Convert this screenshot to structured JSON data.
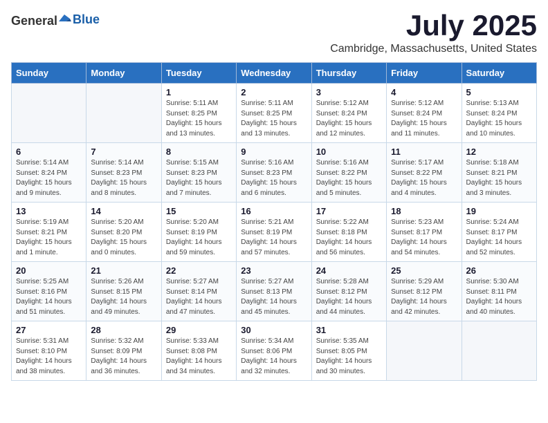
{
  "header": {
    "logo_general": "General",
    "logo_blue": "Blue",
    "month_title": "July 2025",
    "location": "Cambridge, Massachusetts, United States"
  },
  "weekdays": [
    "Sunday",
    "Monday",
    "Tuesday",
    "Wednesday",
    "Thursday",
    "Friday",
    "Saturday"
  ],
  "weeks": [
    [
      {
        "day": "",
        "sunrise": "",
        "sunset": "",
        "daylight": "",
        "empty": true
      },
      {
        "day": "",
        "sunrise": "",
        "sunset": "",
        "daylight": "",
        "empty": true
      },
      {
        "day": "1",
        "sunrise": "Sunrise: 5:11 AM",
        "sunset": "Sunset: 8:25 PM",
        "daylight": "Daylight: 15 hours and 13 minutes.",
        "empty": false
      },
      {
        "day": "2",
        "sunrise": "Sunrise: 5:11 AM",
        "sunset": "Sunset: 8:25 PM",
        "daylight": "Daylight: 15 hours and 13 minutes.",
        "empty": false
      },
      {
        "day": "3",
        "sunrise": "Sunrise: 5:12 AM",
        "sunset": "Sunset: 8:24 PM",
        "daylight": "Daylight: 15 hours and 12 minutes.",
        "empty": false
      },
      {
        "day": "4",
        "sunrise": "Sunrise: 5:12 AM",
        "sunset": "Sunset: 8:24 PM",
        "daylight": "Daylight: 15 hours and 11 minutes.",
        "empty": false
      },
      {
        "day": "5",
        "sunrise": "Sunrise: 5:13 AM",
        "sunset": "Sunset: 8:24 PM",
        "daylight": "Daylight: 15 hours and 10 minutes.",
        "empty": false
      }
    ],
    [
      {
        "day": "6",
        "sunrise": "Sunrise: 5:14 AM",
        "sunset": "Sunset: 8:24 PM",
        "daylight": "Daylight: 15 hours and 9 minutes.",
        "empty": false
      },
      {
        "day": "7",
        "sunrise": "Sunrise: 5:14 AM",
        "sunset": "Sunset: 8:23 PM",
        "daylight": "Daylight: 15 hours and 8 minutes.",
        "empty": false
      },
      {
        "day": "8",
        "sunrise": "Sunrise: 5:15 AM",
        "sunset": "Sunset: 8:23 PM",
        "daylight": "Daylight: 15 hours and 7 minutes.",
        "empty": false
      },
      {
        "day": "9",
        "sunrise": "Sunrise: 5:16 AM",
        "sunset": "Sunset: 8:23 PM",
        "daylight": "Daylight: 15 hours and 6 minutes.",
        "empty": false
      },
      {
        "day": "10",
        "sunrise": "Sunrise: 5:16 AM",
        "sunset": "Sunset: 8:22 PM",
        "daylight": "Daylight: 15 hours and 5 minutes.",
        "empty": false
      },
      {
        "day": "11",
        "sunrise": "Sunrise: 5:17 AM",
        "sunset": "Sunset: 8:22 PM",
        "daylight": "Daylight: 15 hours and 4 minutes.",
        "empty": false
      },
      {
        "day": "12",
        "sunrise": "Sunrise: 5:18 AM",
        "sunset": "Sunset: 8:21 PM",
        "daylight": "Daylight: 15 hours and 3 minutes.",
        "empty": false
      }
    ],
    [
      {
        "day": "13",
        "sunrise": "Sunrise: 5:19 AM",
        "sunset": "Sunset: 8:21 PM",
        "daylight": "Daylight: 15 hours and 1 minute.",
        "empty": false
      },
      {
        "day": "14",
        "sunrise": "Sunrise: 5:20 AM",
        "sunset": "Sunset: 8:20 PM",
        "daylight": "Daylight: 15 hours and 0 minutes.",
        "empty": false
      },
      {
        "day": "15",
        "sunrise": "Sunrise: 5:20 AM",
        "sunset": "Sunset: 8:19 PM",
        "daylight": "Daylight: 14 hours and 59 minutes.",
        "empty": false
      },
      {
        "day": "16",
        "sunrise": "Sunrise: 5:21 AM",
        "sunset": "Sunset: 8:19 PM",
        "daylight": "Daylight: 14 hours and 57 minutes.",
        "empty": false
      },
      {
        "day": "17",
        "sunrise": "Sunrise: 5:22 AM",
        "sunset": "Sunset: 8:18 PM",
        "daylight": "Daylight: 14 hours and 56 minutes.",
        "empty": false
      },
      {
        "day": "18",
        "sunrise": "Sunrise: 5:23 AM",
        "sunset": "Sunset: 8:17 PM",
        "daylight": "Daylight: 14 hours and 54 minutes.",
        "empty": false
      },
      {
        "day": "19",
        "sunrise": "Sunrise: 5:24 AM",
        "sunset": "Sunset: 8:17 PM",
        "daylight": "Daylight: 14 hours and 52 minutes.",
        "empty": false
      }
    ],
    [
      {
        "day": "20",
        "sunrise": "Sunrise: 5:25 AM",
        "sunset": "Sunset: 8:16 PM",
        "daylight": "Daylight: 14 hours and 51 minutes.",
        "empty": false
      },
      {
        "day": "21",
        "sunrise": "Sunrise: 5:26 AM",
        "sunset": "Sunset: 8:15 PM",
        "daylight": "Daylight: 14 hours and 49 minutes.",
        "empty": false
      },
      {
        "day": "22",
        "sunrise": "Sunrise: 5:27 AM",
        "sunset": "Sunset: 8:14 PM",
        "daylight": "Daylight: 14 hours and 47 minutes.",
        "empty": false
      },
      {
        "day": "23",
        "sunrise": "Sunrise: 5:27 AM",
        "sunset": "Sunset: 8:13 PM",
        "daylight": "Daylight: 14 hours and 45 minutes.",
        "empty": false
      },
      {
        "day": "24",
        "sunrise": "Sunrise: 5:28 AM",
        "sunset": "Sunset: 8:12 PM",
        "daylight": "Daylight: 14 hours and 44 minutes.",
        "empty": false
      },
      {
        "day": "25",
        "sunrise": "Sunrise: 5:29 AM",
        "sunset": "Sunset: 8:12 PM",
        "daylight": "Daylight: 14 hours and 42 minutes.",
        "empty": false
      },
      {
        "day": "26",
        "sunrise": "Sunrise: 5:30 AM",
        "sunset": "Sunset: 8:11 PM",
        "daylight": "Daylight: 14 hours and 40 minutes.",
        "empty": false
      }
    ],
    [
      {
        "day": "27",
        "sunrise": "Sunrise: 5:31 AM",
        "sunset": "Sunset: 8:10 PM",
        "daylight": "Daylight: 14 hours and 38 minutes.",
        "empty": false
      },
      {
        "day": "28",
        "sunrise": "Sunrise: 5:32 AM",
        "sunset": "Sunset: 8:09 PM",
        "daylight": "Daylight: 14 hours and 36 minutes.",
        "empty": false
      },
      {
        "day": "29",
        "sunrise": "Sunrise: 5:33 AM",
        "sunset": "Sunset: 8:08 PM",
        "daylight": "Daylight: 14 hours and 34 minutes.",
        "empty": false
      },
      {
        "day": "30",
        "sunrise": "Sunrise: 5:34 AM",
        "sunset": "Sunset: 8:06 PM",
        "daylight": "Daylight: 14 hours and 32 minutes.",
        "empty": false
      },
      {
        "day": "31",
        "sunrise": "Sunrise: 5:35 AM",
        "sunset": "Sunset: 8:05 PM",
        "daylight": "Daylight: 14 hours and 30 minutes.",
        "empty": false
      },
      {
        "day": "",
        "sunrise": "",
        "sunset": "",
        "daylight": "",
        "empty": true
      },
      {
        "day": "",
        "sunrise": "",
        "sunset": "",
        "daylight": "",
        "empty": true
      }
    ]
  ]
}
